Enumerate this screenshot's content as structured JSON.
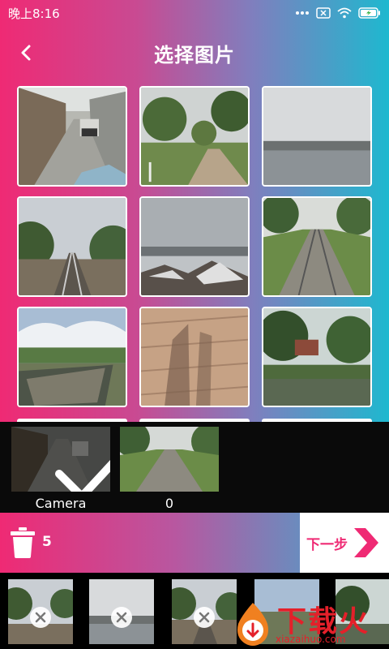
{
  "status": {
    "time": "晚上8:16"
  },
  "header": {
    "title": "选择图片"
  },
  "albums": [
    {
      "label": "Camera",
      "selected": true
    },
    {
      "label": "0",
      "selected": false
    }
  ],
  "action_bar": {
    "count": "5",
    "next_label": "下一步"
  },
  "watermark": {
    "text": "下载火",
    "sub": "xiazaihuo.com"
  },
  "colors": {
    "accent": "#ef2a74",
    "cyan": "#1eb8cf"
  }
}
